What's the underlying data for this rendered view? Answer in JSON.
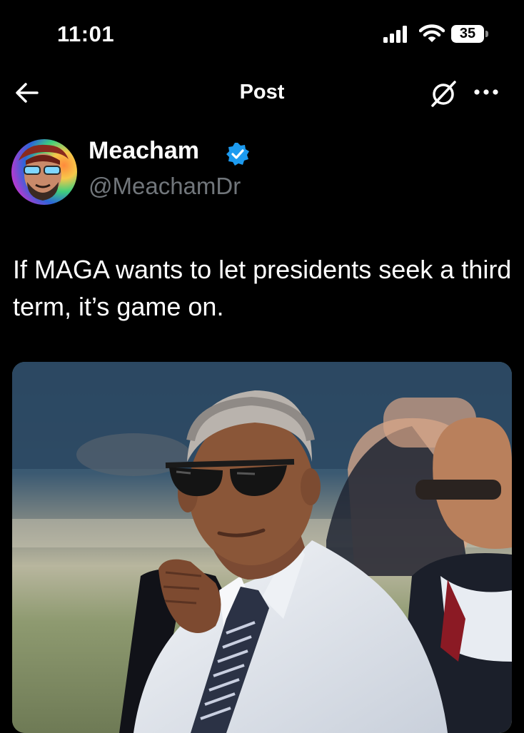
{
  "status_bar": {
    "time": "11:01",
    "battery_level": "35",
    "icons": [
      "signal-icon",
      "wifi-icon",
      "battery-icon"
    ]
  },
  "nav": {
    "title": "Post",
    "icons": [
      "back-arrow-icon",
      "grok-icon",
      "more-icon"
    ]
  },
  "post": {
    "author": {
      "display_name": "Meacham",
      "handle": "@MeachamDr",
      "verified": true,
      "verified_color": "#1d9bf0"
    },
    "text": "If MAGA wants to let presidents seek a third term, it’s game on."
  },
  "colors": {
    "background": "#000000",
    "text_primary": "#e7e9ea",
    "text_secondary": "#71767b",
    "accent": "#1d9bf0"
  }
}
